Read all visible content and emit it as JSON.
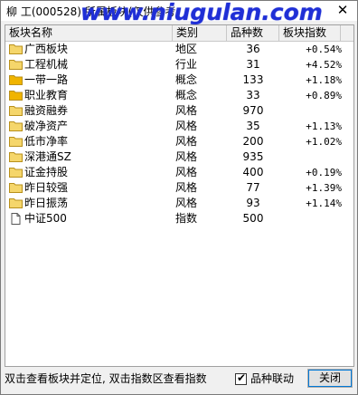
{
  "window": {
    "title": "柳 工(000528) 所属板块(仅供参考",
    "watermark": "www.niugulan.com"
  },
  "table": {
    "headers": [
      "板块名称",
      "类别",
      "品种数",
      "板块指数"
    ],
    "rows": [
      {
        "icon": "folder-icon",
        "name": "广西板块",
        "type": "地区",
        "count": "36",
        "index": "+0.54%"
      },
      {
        "icon": "folder-icon",
        "name": "工程机械",
        "type": "行业",
        "count": "31",
        "index": "+4.52%"
      },
      {
        "icon": "folder-gold-icon",
        "name": "一带一路",
        "type": "概念",
        "count": "133",
        "index": "+1.18%"
      },
      {
        "icon": "folder-gold-icon",
        "name": "职业教育",
        "type": "概念",
        "count": "33",
        "index": "+0.89%"
      },
      {
        "icon": "folder-icon",
        "name": "融资融券",
        "type": "风格",
        "count": "970",
        "index": ""
      },
      {
        "icon": "folder-icon",
        "name": "破净资产",
        "type": "风格",
        "count": "35",
        "index": "+1.13%"
      },
      {
        "icon": "folder-icon",
        "name": "低市净率",
        "type": "风格",
        "count": "200",
        "index": "+1.02%"
      },
      {
        "icon": "folder-icon",
        "name": "深港通SZ",
        "type": "风格",
        "count": "935",
        "index": ""
      },
      {
        "icon": "folder-icon",
        "name": "证金持股",
        "type": "风格",
        "count": "400",
        "index": "+0.19%"
      },
      {
        "icon": "folder-icon",
        "name": "昨日较强",
        "type": "风格",
        "count": "77",
        "index": "+1.39%"
      },
      {
        "icon": "folder-icon",
        "name": "昨日振荡",
        "type": "风格",
        "count": "93",
        "index": "+1.14%"
      },
      {
        "icon": "document-icon",
        "name": "中证500",
        "type": "指数",
        "count": "500",
        "index": ""
      }
    ]
  },
  "footer": {
    "status_text": "双击查看板块并定位, 双击指数区查看指数",
    "linkage_label": "品种联动",
    "linkage_checked": true,
    "close_label": "关闭"
  },
  "colors": {
    "folder": "#f5d66b",
    "folder_gold": "#f0b400",
    "watermark": "#1f2fd6"
  }
}
